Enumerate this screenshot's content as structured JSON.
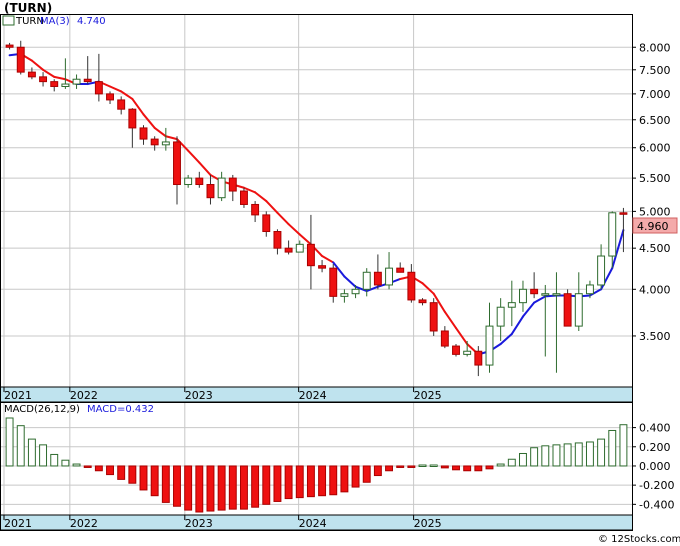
{
  "ticker_title": "(TURN)",
  "legend_ticker": "TURN",
  "legend_ma_label": "MA(3)",
  "legend_ma_value": "4.740",
  "macd_label": "MACD(26,12,9)",
  "macd_value_label": "MACD=0.432",
  "current_price_label": "4.960",
  "watermark": "© 12Stocks.com",
  "colors": {
    "up": "#ffffff",
    "up_outline": "#2e6b2e",
    "down": "#ee1111",
    "ma_down": "#ee1111",
    "ma_up": "#1a1adc",
    "grid": "#c8c8c8",
    "axis_band": "#bfe3ee",
    "macd_pos": "#2e6b2e",
    "macd_neg": "#ee1111",
    "price_tag": "#f4aaaa"
  },
  "chart_data": [
    {
      "type": "candlestick",
      "title": "(TURN)",
      "x_axis_labels": [
        "2021",
        "2022",
        "2023",
        "2024",
        "2025"
      ],
      "y_ticks": [
        3.5,
        4.0,
        4.5,
        5.0,
        5.5,
        6.0,
        6.5,
        7.0,
        7.5,
        8.0
      ],
      "y_tick_labels": [
        "3.500",
        "4.000",
        "4.500",
        "5.000",
        "5.500",
        "6.000",
        "6.500",
        "7.000",
        "7.500",
        "8.000"
      ],
      "y_scale": "log",
      "ylim": [
        3.05,
        8.6
      ],
      "grid": true,
      "ohlc": [
        [
          8.05,
          8.1,
          7.95,
          8.0
        ],
        [
          8.0,
          8.15,
          7.4,
          7.45
        ],
        [
          7.45,
          7.55,
          7.3,
          7.35
        ],
        [
          7.35,
          7.45,
          7.15,
          7.25
        ],
        [
          7.25,
          7.3,
          7.05,
          7.15
        ],
        [
          7.15,
          7.75,
          7.1,
          7.2
        ],
        [
          7.2,
          7.4,
          7.1,
          7.3
        ],
        [
          7.3,
          7.8,
          7.2,
          7.25
        ],
        [
          7.25,
          7.85,
          6.85,
          7.0
        ],
        [
          7.0,
          7.05,
          6.8,
          6.88
        ],
        [
          6.88,
          6.95,
          6.6,
          6.7
        ],
        [
          6.7,
          6.72,
          6.0,
          6.35
        ],
        [
          6.35,
          6.4,
          6.05,
          6.15
        ],
        [
          6.15,
          6.2,
          5.95,
          6.05
        ],
        [
          6.05,
          6.35,
          5.95,
          6.1
        ],
        [
          6.1,
          6.2,
          5.1,
          5.4
        ],
        [
          5.4,
          5.55,
          5.35,
          5.5
        ],
        [
          5.5,
          5.6,
          5.35,
          5.4
        ],
        [
          5.4,
          5.55,
          5.1,
          5.2
        ],
        [
          5.2,
          5.6,
          5.15,
          5.5
        ],
        [
          5.5,
          5.55,
          5.15,
          5.3
        ],
        [
          5.3,
          5.35,
          5.05,
          5.1
        ],
        [
          5.1,
          5.15,
          4.85,
          4.95
        ],
        [
          4.95,
          5.0,
          4.65,
          4.72
        ],
        [
          4.72,
          4.75,
          4.42,
          4.5
        ],
        [
          4.5,
          4.6,
          4.42,
          4.45
        ],
        [
          4.45,
          4.6,
          4.45,
          4.55
        ],
        [
          4.55,
          4.95,
          4.0,
          4.28
        ],
        [
          4.28,
          4.35,
          4.2,
          4.25
        ],
        [
          4.25,
          4.3,
          3.85,
          3.92
        ],
        [
          3.92,
          4.0,
          3.85,
          3.95
        ],
        [
          3.95,
          4.05,
          3.9,
          4.0
        ],
        [
          4.0,
          4.25,
          3.92,
          4.2
        ],
        [
          4.2,
          4.42,
          4.0,
          4.05
        ],
        [
          4.05,
          4.45,
          4.0,
          4.25
        ],
        [
          4.25,
          4.32,
          4.2,
          4.2
        ],
        [
          4.2,
          4.3,
          3.85,
          3.88
        ],
        [
          3.88,
          3.9,
          3.82,
          3.85
        ],
        [
          3.85,
          3.9,
          3.5,
          3.55
        ],
        [
          3.55,
          3.6,
          3.38,
          3.4
        ],
        [
          3.4,
          3.42,
          3.3,
          3.32
        ],
        [
          3.32,
          3.45,
          3.3,
          3.35
        ],
        [
          3.35,
          3.4,
          3.12,
          3.22
        ],
        [
          3.22,
          3.85,
          3.15,
          3.6
        ],
        [
          3.6,
          3.9,
          3.45,
          3.8
        ],
        [
          3.8,
          4.1,
          3.6,
          3.85
        ],
        [
          3.85,
          4.1,
          3.75,
          4.0
        ],
        [
          4.0,
          4.2,
          3.9,
          3.95
        ],
        [
          3.95,
          4.05,
          3.3,
          3.95
        ],
        [
          3.95,
          4.2,
          3.15,
          3.95
        ],
        [
          3.95,
          4.0,
          3.6,
          3.6
        ],
        [
          3.6,
          4.2,
          3.55,
          3.95
        ],
        [
          3.95,
          4.1,
          3.9,
          4.05
        ],
        [
          4.05,
          4.55,
          4.0,
          4.4
        ],
        [
          4.4,
          5.0,
          4.25,
          4.98
        ],
        [
          4.98,
          5.05,
          4.45,
          4.96
        ]
      ],
      "ma3_values": [
        7.82,
        7.85,
        7.7,
        7.5,
        7.35,
        7.3,
        7.2,
        7.2,
        7.25,
        7.15,
        7.05,
        6.9,
        6.6,
        6.35,
        6.2,
        6.15,
        5.95,
        5.75,
        5.55,
        5.45,
        5.4,
        5.35,
        5.28,
        5.15,
        4.98,
        4.82,
        4.68,
        4.55,
        4.4,
        4.32,
        4.15,
        4.03,
        3.98,
        4.03,
        4.07,
        4.12,
        4.15,
        4.07,
        3.95,
        3.75,
        3.58,
        3.42,
        3.32,
        3.35,
        3.42,
        3.52,
        3.7,
        3.85,
        3.92,
        3.93,
        3.93,
        3.92,
        3.93,
        4.0,
        4.25,
        4.74
      ],
      "ma3_trend": [
        "up",
        "up",
        "down",
        "down",
        "down",
        "down",
        "down",
        "up",
        "up",
        "down",
        "down",
        "down",
        "down",
        "down",
        "down",
        "down",
        "down",
        "down",
        "down",
        "down",
        "down",
        "down",
        "down",
        "down",
        "down",
        "down",
        "down",
        "down",
        "down",
        "down",
        "up",
        "up",
        "up",
        "up",
        "up",
        "up",
        "down",
        "down",
        "down",
        "down",
        "down",
        "down",
        "down",
        "up",
        "up",
        "up",
        "up",
        "up",
        "up",
        "up",
        "up",
        "up",
        "up",
        "up",
        "up",
        "up"
      ]
    },
    {
      "type": "bar",
      "title": "MACD(26,12,9)",
      "x_axis_labels": [
        "2021",
        "2022",
        "2023",
        "2024",
        "2025"
      ],
      "y_ticks": [
        0.4,
        0.2,
        0.0,
        -0.2,
        -0.4
      ],
      "y_tick_labels": [
        "0.400",
        "0.200",
        "0.000",
        "-0.200",
        "-0.400"
      ],
      "ylim": [
        -0.48,
        0.5
      ],
      "grid": true,
      "values": [
        0.5,
        0.42,
        0.28,
        0.22,
        0.12,
        0.06,
        0.02,
        -0.01,
        -0.05,
        -0.09,
        -0.14,
        -0.18,
        -0.25,
        -0.31,
        -0.38,
        -0.42,
        -0.46,
        -0.48,
        -0.47,
        -0.46,
        -0.45,
        -0.45,
        -0.43,
        -0.4,
        -0.37,
        -0.34,
        -0.33,
        -0.32,
        -0.31,
        -0.3,
        -0.27,
        -0.22,
        -0.17,
        -0.1,
        -0.05,
        -0.01,
        -0.01,
        0.01,
        0.01,
        -0.02,
        -0.04,
        -0.05,
        -0.05,
        -0.03,
        0.02,
        0.07,
        0.13,
        0.19,
        0.21,
        0.22,
        0.23,
        0.24,
        0.25,
        0.28,
        0.37,
        0.43
      ]
    }
  ]
}
